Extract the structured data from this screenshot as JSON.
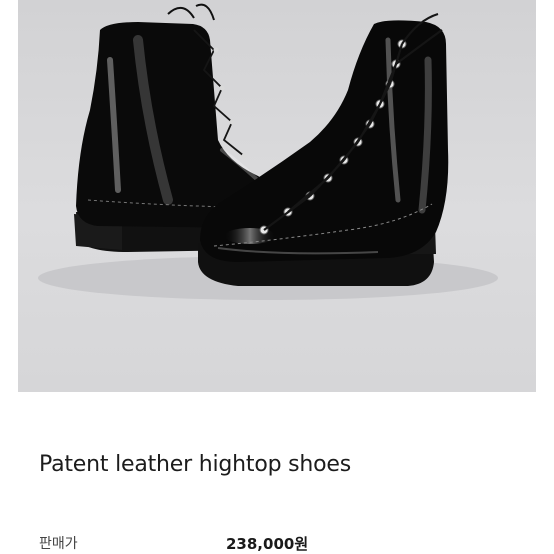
{
  "product": {
    "image_alt": "Black patent leather lace-up high-top boots",
    "title": "Patent leather hightop shoes",
    "price_label": "판매가",
    "price_value": "238,000원"
  },
  "colors": {
    "background": "#ffffff",
    "photo_background": "#d8d8da",
    "boot_black": "#0a0a0a",
    "title_text": "#1c1c1c"
  }
}
